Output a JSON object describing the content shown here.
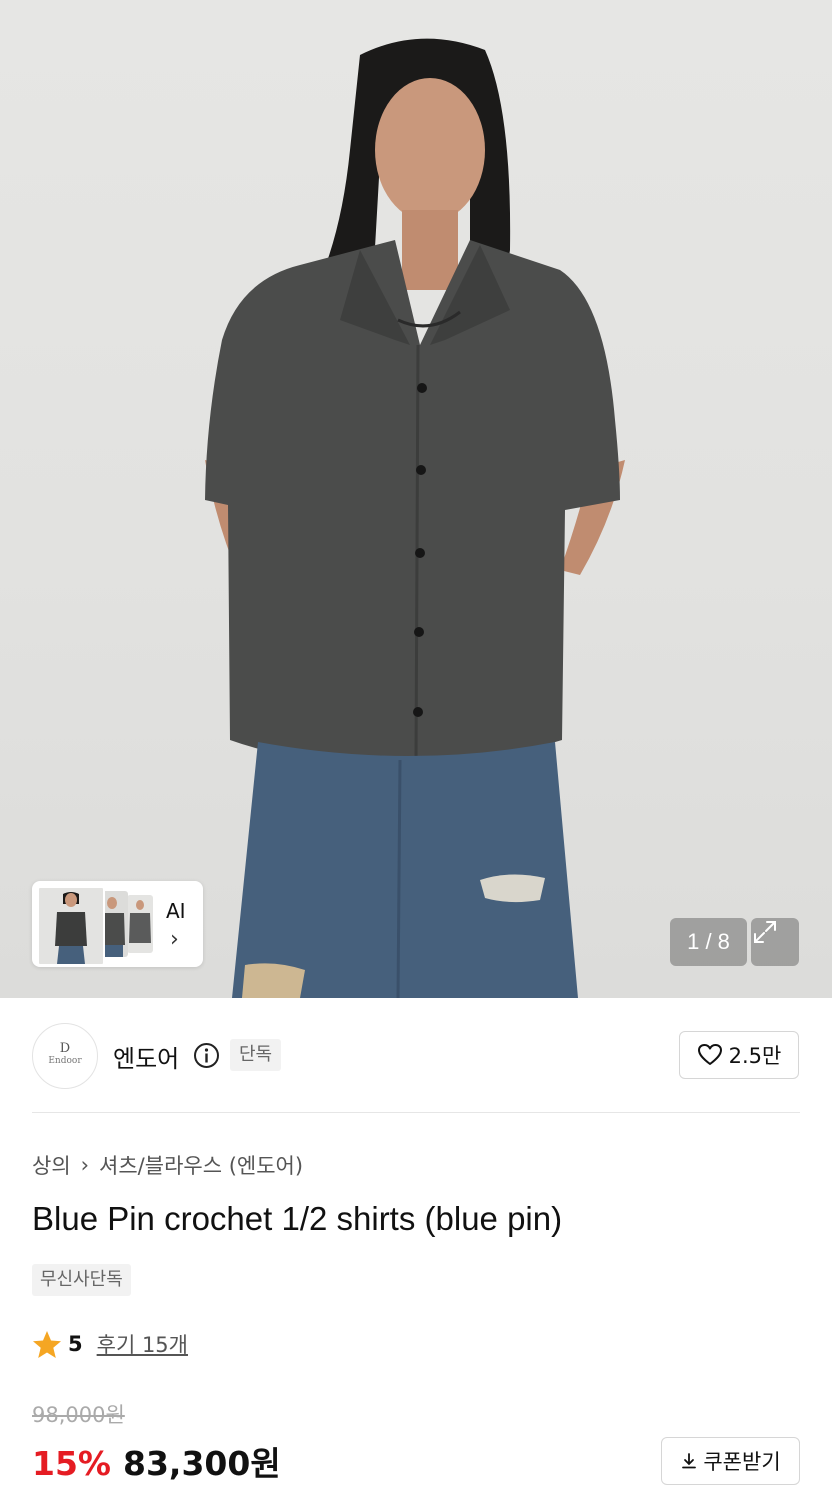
{
  "gallery": {
    "counter": "1 / 8",
    "ai_label": "AI",
    "ai_chevron": "›",
    "expand_icon": "expand-arrows-icon"
  },
  "brand": {
    "logo_mark": "D",
    "logo_word": "Endoor",
    "name": "엔도어",
    "tag": "단독",
    "likes": "2.5만",
    "info_icon": "info-circle-icon",
    "like_icon": "heart-outline-icon"
  },
  "product": {
    "breadcrumb": [
      "상의",
      "셔츠/블라우스 (엔도어)"
    ],
    "breadcrumb_separator": "›",
    "title": "Blue Pin crochet 1/2 shirts (blue pin)",
    "tag": "무신사단독",
    "rating": "5",
    "reviews": "후기 15개",
    "original_price": "98,000원",
    "discount": "15%",
    "price": "83,300원",
    "coupon_label": "쿠폰받기",
    "coupon_icon": "download-icon"
  },
  "colors": {
    "discount": "#e51c23",
    "star": "#f5a623",
    "tag_bg": "#f2f2f2"
  }
}
